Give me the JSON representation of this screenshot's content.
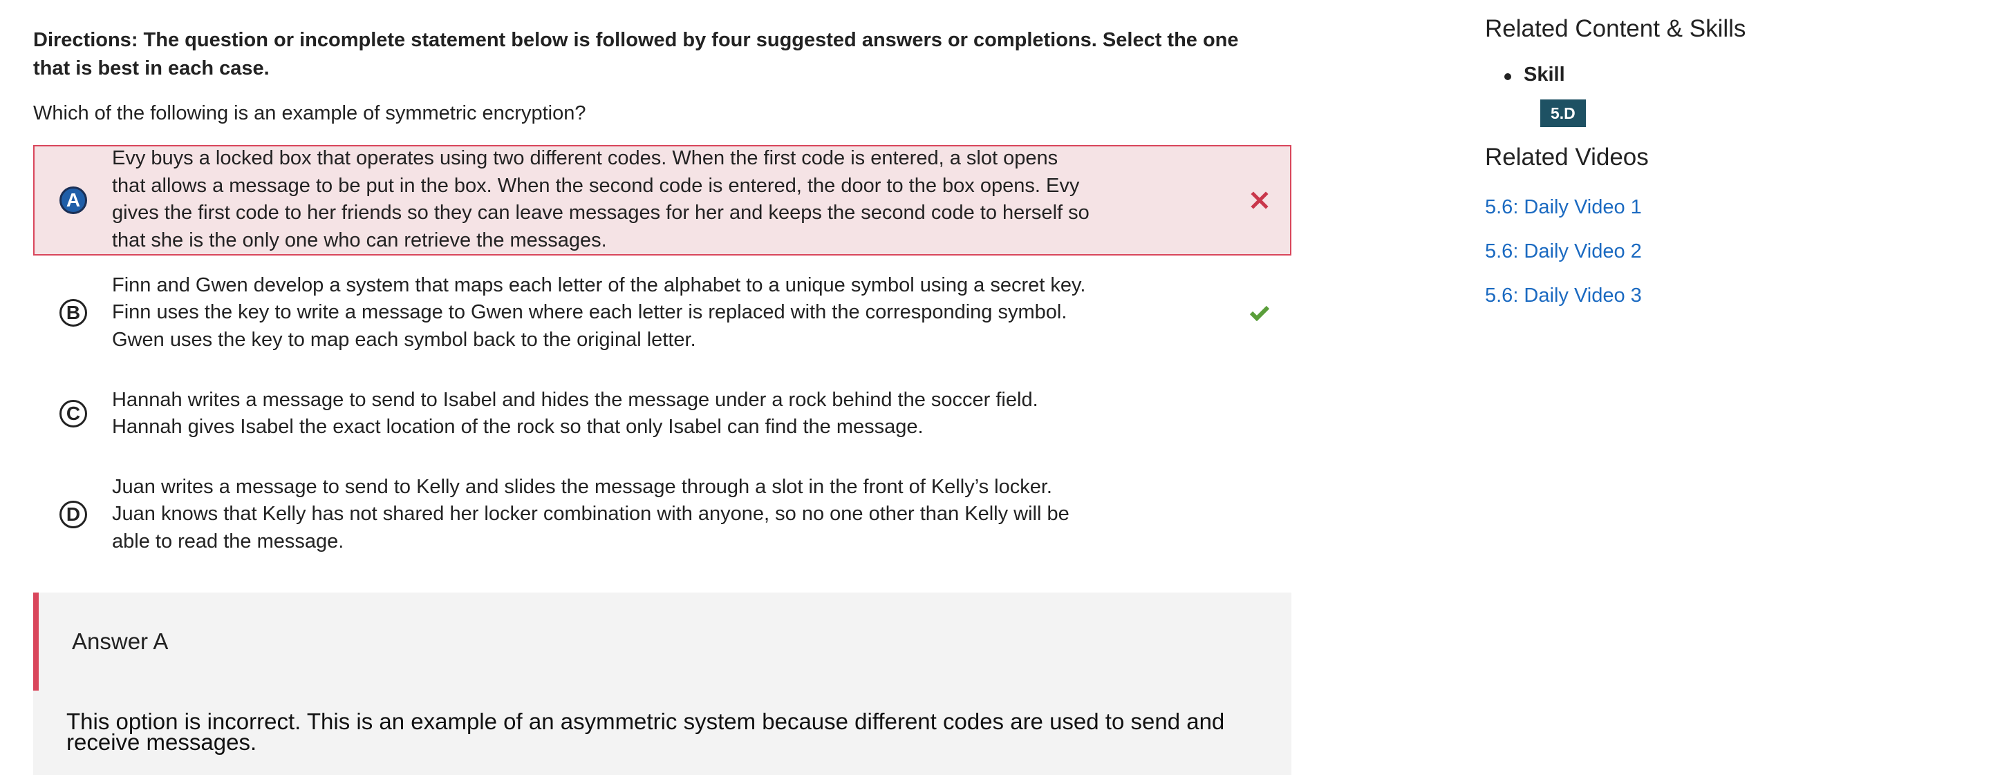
{
  "directions": "Directions: The question or incomplete statement below is followed by four suggested answers or completions. Select the one that is best in each case.",
  "question": "Which of the following is an example of symmetric encryption?",
  "choices": [
    {
      "letter": "A",
      "text": "Evy buys a locked box that operates using two different codes. When the first code is entered, a slot opens that allows a message to be put in the box. When the second code is entered, the door to the box opens. Evy gives the first code to her friends so they can leave messages for her and keeps the second code to herself so that she is the only one who can retrieve the messages.",
      "status": "incorrect-selected",
      "mark_icon": "x-icon"
    },
    {
      "letter": "B",
      "text": "Finn and Gwen develop a system that maps each letter of the alphabet to a unique symbol using a secret key. Finn uses the key to write a message to Gwen where each letter is replaced with the corresponding symbol. Gwen uses the key to map each symbol back to the original letter.",
      "status": "correct",
      "mark_icon": "check-icon"
    },
    {
      "letter": "C",
      "text": "Hannah writes a message to send to Isabel and hides the message under a rock behind the soccer field. Hannah gives Isabel the exact location of the rock so that only Isabel can find the message.",
      "status": "none"
    },
    {
      "letter": "D",
      "text": "Juan writes a message to send to Kelly and slides the message through a slot in the front of Kelly’s locker. Juan knows that Kelly has not shared her locker combination with anyone, so no one other than Kelly will be able to read the message.",
      "status": "none"
    }
  ],
  "answer": {
    "heading": "Answer A",
    "explanation": "This option is incorrect. This is an example of an asymmetric system because different codes are used to send and receive messages."
  },
  "sidebar": {
    "related_heading": "Related Content & Skills",
    "skill_label": "Skill",
    "skill_badge": "5.D",
    "videos_heading": "Related Videos",
    "videos": [
      "5.6: Daily Video 1",
      "5.6: Daily Video 2",
      "5.6: Daily Video 3"
    ]
  },
  "colors": {
    "incorrect": "#d9465b",
    "incorrect_bg": "#f5e3e5",
    "correct": "#5a9e3a",
    "selected_circle": "#1f5ea8",
    "badge": "#1e5163",
    "link": "#1b6ac1"
  }
}
